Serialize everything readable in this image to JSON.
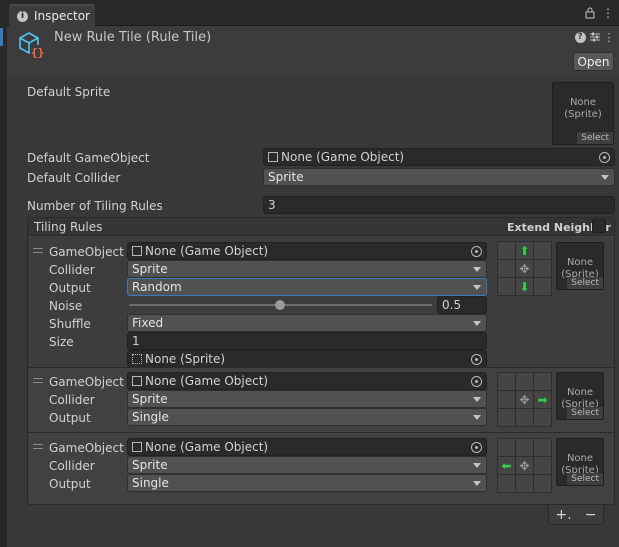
{
  "tab": {
    "title": "Inspector",
    "icon": "info-icon"
  },
  "header": {
    "title": "New Rule Tile (Rule Tile)",
    "open_label": "Open",
    "icons": [
      "help-icon",
      "presets-icon",
      "more-icon"
    ]
  },
  "fields": {
    "default_sprite_label": "Default Sprite",
    "default_sprite_value": "None\n(Sprite)",
    "sprite_select": "Select",
    "default_gameobject_label": "Default GameObject",
    "default_gameobject_value": "None (Game Object)",
    "default_collider_label": "Default Collider",
    "default_collider_value": "Sprite",
    "num_rules_label": "Number of Tiling Rules",
    "num_rules_value": "3"
  },
  "tiling": {
    "header": "Tiling Rules",
    "extend_neighbor": "Extend Neighbor"
  },
  "rules": [
    {
      "gameobject_label": "GameObject",
      "gameobject_value": "None (Game Object)",
      "collider_label": "Collider",
      "collider_value": "Sprite",
      "output_label": "Output",
      "output_value": "Random",
      "noise_label": "Noise",
      "noise_value": "0.5",
      "noise_fraction": 0.5,
      "shuffle_label": "Shuffle",
      "shuffle_value": "Fixed",
      "size_label": "Size",
      "size_value": "1",
      "sprite_value": "None (Sprite)",
      "sprite_box": "None\n(Sprite)",
      "sprite_select": "Select"
    },
    {
      "gameobject_label": "GameObject",
      "gameobject_value": "None (Game Object)",
      "collider_label": "Collider",
      "collider_value": "Sprite",
      "output_label": "Output",
      "output_value": "Single",
      "sprite_box": "None\n(Sprite)",
      "sprite_select": "Select"
    },
    {
      "gameobject_label": "GameObject",
      "gameobject_value": "None (Game Object)",
      "collider_label": "Collider",
      "collider_value": "Sprite",
      "output_label": "Output",
      "output_value": "Single",
      "sprite_box": "None\n(Sprite)",
      "sprite_select": "Select"
    }
  ],
  "footer": {
    "add": "+.",
    "remove": "−"
  },
  "colors": {
    "accent": "#3a79bb",
    "arrow": "#2fd14f"
  }
}
